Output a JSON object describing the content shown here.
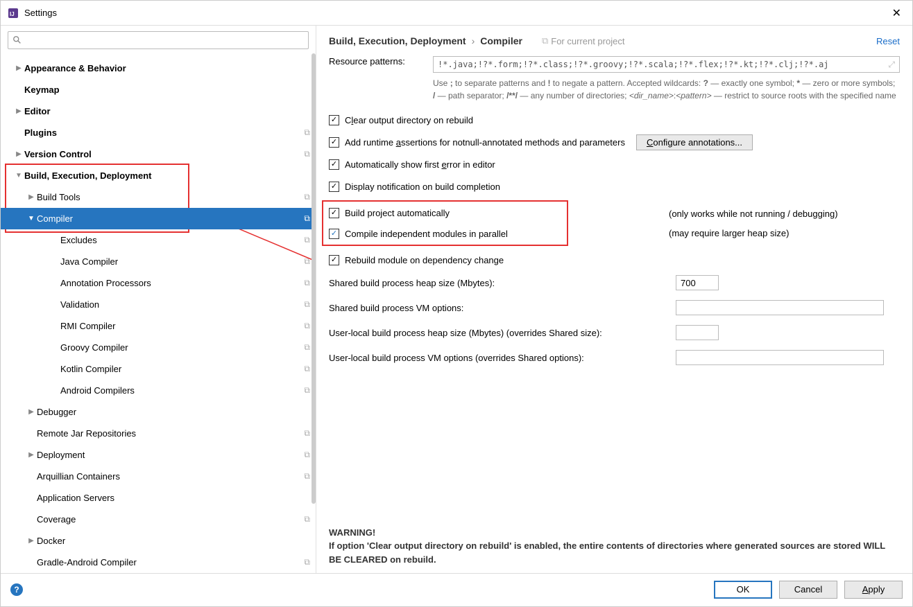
{
  "titlebar": {
    "title": "Settings"
  },
  "sidebar": {
    "search_placeholder": "",
    "items": [
      {
        "label": "Appearance & Behavior",
        "indent": 0,
        "chevron": "right",
        "bold": true,
        "copy": false
      },
      {
        "label": "Keymap",
        "indent": 0,
        "chevron": "none",
        "bold": true,
        "copy": false
      },
      {
        "label": "Editor",
        "indent": 0,
        "chevron": "right",
        "bold": true,
        "copy": false
      },
      {
        "label": "Plugins",
        "indent": 0,
        "chevron": "none",
        "bold": true,
        "copy": true
      },
      {
        "label": "Version Control",
        "indent": 0,
        "chevron": "right",
        "bold": true,
        "copy": true
      },
      {
        "label": "Build, Execution, Deployment",
        "indent": 0,
        "chevron": "down",
        "bold": true,
        "copy": false
      },
      {
        "label": "Build Tools",
        "indent": 1,
        "chevron": "right",
        "bold": false,
        "copy": true
      },
      {
        "label": "Compiler",
        "indent": 1,
        "chevron": "down",
        "bold": false,
        "copy": true,
        "selected": true
      },
      {
        "label": "Excludes",
        "indent": 2,
        "chevron": "none",
        "bold": false,
        "copy": true
      },
      {
        "label": "Java Compiler",
        "indent": 2,
        "chevron": "none",
        "bold": false,
        "copy": true
      },
      {
        "label": "Annotation Processors",
        "indent": 2,
        "chevron": "none",
        "bold": false,
        "copy": true
      },
      {
        "label": "Validation",
        "indent": 2,
        "chevron": "none",
        "bold": false,
        "copy": true
      },
      {
        "label": "RMI Compiler",
        "indent": 2,
        "chevron": "none",
        "bold": false,
        "copy": true
      },
      {
        "label": "Groovy Compiler",
        "indent": 2,
        "chevron": "none",
        "bold": false,
        "copy": true
      },
      {
        "label": "Kotlin Compiler",
        "indent": 2,
        "chevron": "none",
        "bold": false,
        "copy": true
      },
      {
        "label": "Android Compilers",
        "indent": 2,
        "chevron": "none",
        "bold": false,
        "copy": true
      },
      {
        "label": "Debugger",
        "indent": 1,
        "chevron": "right",
        "bold": false,
        "copy": false
      },
      {
        "label": "Remote Jar Repositories",
        "indent": 1,
        "chevron": "none",
        "bold": false,
        "copy": true
      },
      {
        "label": "Deployment",
        "indent": 1,
        "chevron": "right",
        "bold": false,
        "copy": true
      },
      {
        "label": "Arquillian Containers",
        "indent": 1,
        "chevron": "none",
        "bold": false,
        "copy": true
      },
      {
        "label": "Application Servers",
        "indent": 1,
        "chevron": "none",
        "bold": false,
        "copy": false
      },
      {
        "label": "Coverage",
        "indent": 1,
        "chevron": "none",
        "bold": false,
        "copy": true
      },
      {
        "label": "Docker",
        "indent": 1,
        "chevron": "right",
        "bold": false,
        "copy": false
      },
      {
        "label": "Gradle-Android Compiler",
        "indent": 1,
        "chevron": "none",
        "bold": false,
        "copy": true
      }
    ]
  },
  "content": {
    "breadcrumb_root": "Build, Execution, Deployment",
    "breadcrumb_leaf": "Compiler",
    "for_project_label": "For current project",
    "reset_label": "Reset",
    "resource_label": "Resource patterns:",
    "resource_value": "!*.java;!?*.form;!?*.class;!?*.groovy;!?*.scala;!?*.flex;!?*.kt;!?*.clj;!?*.aj",
    "help_text": "Use ; to separate patterns and ! to negate a pattern. Accepted wildcards: ? — exactly one symbol; * — zero or more symbols; / — path separator; /**/ — any number of directories; <dir_name>:<pattern> — restrict to source roots with the specified name",
    "chk_clear": "Clear output directory on rebuild",
    "chk_runtime": "Add runtime assertions for notnull-annotated methods and parameters",
    "cfg_ann_label": "Configure annotations...",
    "chk_auto_err": "Automatically show first error in editor",
    "chk_notify": "Display notification on build completion",
    "chk_build_auto": "Build project automatically",
    "chk_build_auto_note": "(only works while not running / debugging)",
    "chk_parallel": "Compile independent modules in parallel",
    "chk_parallel_note": "(may require larger heap size)",
    "chk_rebuild_dep": "Rebuild module on dependency change",
    "fld_heap_label": "Shared build process heap size (Mbytes):",
    "fld_heap_value": "700",
    "fld_vm_label": "Shared build process VM options:",
    "fld_vm_value": "",
    "fld_user_heap_label": "User-local build process heap size (Mbytes) (overrides Shared size):",
    "fld_user_heap_value": "",
    "fld_user_vm_label": "User-local build process VM options (overrides Shared options):",
    "fld_user_vm_value": "",
    "warning_title": "WARNING!",
    "warning_body": "If option 'Clear output directory on rebuild' is enabled, the entire contents of directories where generated sources are stored WILL BE CLEARED on rebuild."
  },
  "footer": {
    "ok": "OK",
    "cancel": "Cancel",
    "apply": "Apply"
  }
}
